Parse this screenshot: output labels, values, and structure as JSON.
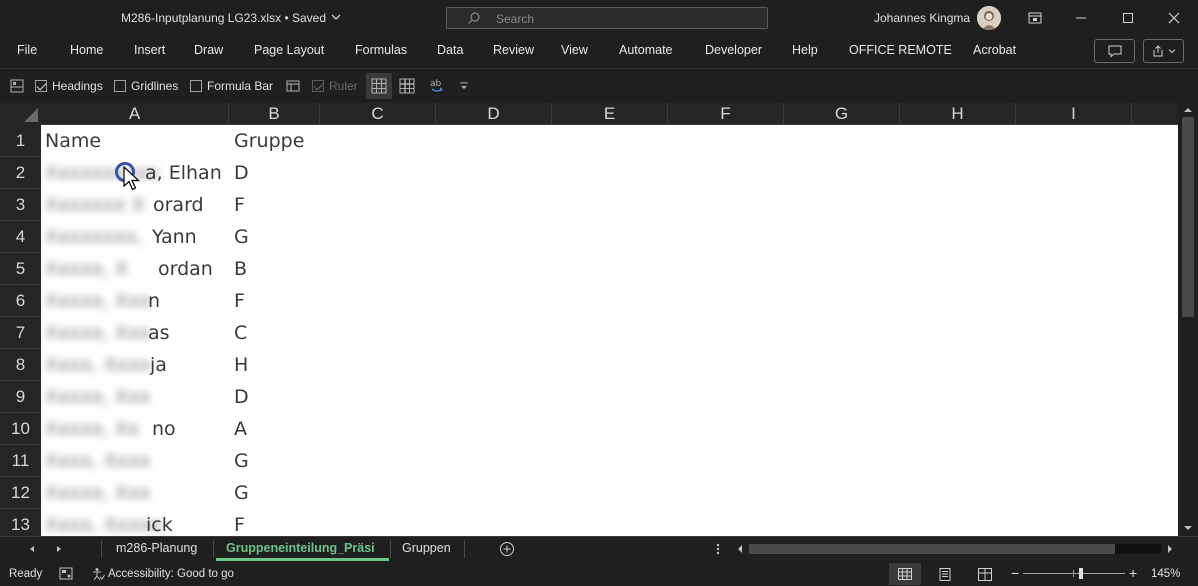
{
  "titlebar": {
    "filename": "M286-Inputplanung LG23.xlsx",
    "save_status": "Saved",
    "search_placeholder": "Search",
    "username": "Johannes Kingma"
  },
  "menu": {
    "items": [
      "File",
      "Home",
      "Insert",
      "Draw",
      "Page Layout",
      "Formulas",
      "Data",
      "Review",
      "View",
      "Automate",
      "Developer",
      "Help",
      "OFFICE REMOTE",
      "Acrobat"
    ]
  },
  "toolbar": {
    "headings_label": "Headings",
    "headings_checked": true,
    "gridlines_label": "Gridlines",
    "gridlines_checked": false,
    "formula_bar_label": "Formula Bar",
    "formula_bar_checked": false,
    "ruler_label": "Ruler",
    "ruler_checked": true
  },
  "sheet": {
    "columns": [
      "A",
      "B",
      "C",
      "D",
      "E",
      "F",
      "G",
      "H",
      "I"
    ],
    "rows": [
      {
        "num": "1",
        "name": "Name",
        "name_visible": "",
        "group": "Gruppe"
      },
      {
        "num": "2",
        "name": "",
        "name_visible": "a, Elhan",
        "group": "D"
      },
      {
        "num": "3",
        "name": "",
        "name_visible": "orard",
        "group": "F"
      },
      {
        "num": "4",
        "name": "",
        "name_visible": "Yann",
        "group": "G"
      },
      {
        "num": "5",
        "name": "",
        "name_visible": "ordan",
        "group": "B"
      },
      {
        "num": "6",
        "name": "",
        "name_visible": "n",
        "group": "F"
      },
      {
        "num": "7",
        "name": "",
        "name_visible": "as",
        "group": "C"
      },
      {
        "num": "8",
        "name": "",
        "name_visible": "ja",
        "group": "H"
      },
      {
        "num": "9",
        "name": "",
        "name_visible": "",
        "group": "D"
      },
      {
        "num": "10",
        "name": "",
        "name_visible": "no",
        "group": "A"
      },
      {
        "num": "11",
        "name": "",
        "name_visible": "",
        "group": "G"
      },
      {
        "num": "12",
        "name": "",
        "name_visible": "",
        "group": "G"
      },
      {
        "num": "13",
        "name": "",
        "name_visible": "ick",
        "group": "F"
      }
    ]
  },
  "tabs": {
    "items": [
      "m286-Planung",
      "Gruppeneinteilung_Präsi",
      "Gruppen"
    ],
    "active": "Gruppeneinteilung_Präsi"
  },
  "status": {
    "ready": "Ready",
    "accessibility": "Accessibility: Good to go",
    "zoom": "145%",
    "zoom_minus": "−",
    "zoom_plus": "+"
  },
  "colors": {
    "accent_green": "#6cc48a",
    "cursor_ring": "#3b4fb0"
  }
}
